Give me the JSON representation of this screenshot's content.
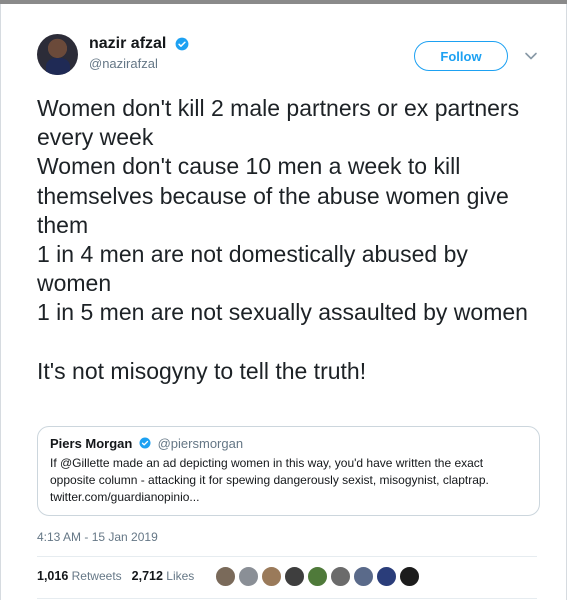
{
  "tweet": {
    "display_name": "nazir afzal",
    "handle": "@nazirafzal",
    "follow_label": "Follow",
    "text": "Women don't kill 2 male partners or ex partners every week\nWomen don't cause 10 men a week to kill themselves because of the abuse women give them\n1 in 4 men are not domestically abused by women\n1 in 5 men are not sexually assaulted by women\n\nIt's not misogyny to tell the truth!",
    "timestamp": "4:13 AM - 15 Jan 2019",
    "retweets_count": "1,016",
    "retweets_label": "Retweets",
    "likes_count": "2,712",
    "likes_label": "Likes"
  },
  "quoted_tweet": {
    "display_name": "Piers Morgan",
    "handle": "@piersmorgan",
    "text": "If @Gillette made an ad depicting women in this way, you'd have written the exact opposite column - attacking it for spewing dangerously sexist, misogynist, claptrap. twitter.com/guardianopinio..."
  },
  "likers": [
    {
      "name": "liker-avatar",
      "color": "#7a6a5a"
    },
    {
      "name": "liker-avatar",
      "color": "#8a8f96"
    },
    {
      "name": "liker-avatar",
      "color": "#9a7a5a"
    },
    {
      "name": "liker-avatar",
      "color": "#3e3e3e"
    },
    {
      "name": "liker-avatar",
      "color": "#4f7a3a"
    },
    {
      "name": "liker-avatar",
      "color": "#6b6b6b"
    },
    {
      "name": "liker-avatar",
      "color": "#5a6a8a"
    },
    {
      "name": "liker-avatar",
      "color": "#2a3d7a"
    },
    {
      "name": "liker-avatar",
      "color": "#1c1c1c"
    }
  ],
  "icons": {
    "verified": "verified-badge-icon",
    "caret": "chevron-down-icon"
  },
  "colors": {
    "accent": "#1da1f2",
    "secondary_text": "#657786"
  }
}
